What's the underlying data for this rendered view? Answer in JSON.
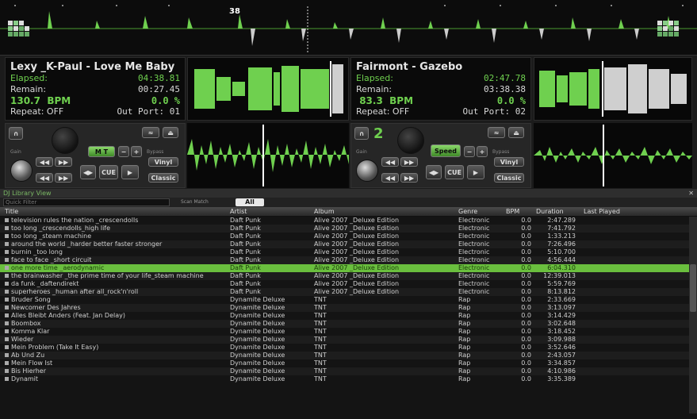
{
  "overview": {
    "beat_marker": "38"
  },
  "deck1": {
    "title": "Lexy _K-Paul - Love Me Baby",
    "elapsed_label": "Elapsed:",
    "elapsed": "04:38.81",
    "remain_label": "Remain:",
    "remain": "00:27.45",
    "bpm": "130.7",
    "bpm_label": "BPM",
    "pitch": "0.0 %",
    "repeat": "Repeat: OFF",
    "out_port": "Out Port: 01",
    "sync_label": "M T",
    "cue_label": "CUE",
    "vinyl_label": "Vinyl",
    "classic_label": "Classic",
    "gain_label": "Gain",
    "bypass_label": "Bypass"
  },
  "deck2": {
    "title": "Fairmont - Gazebo",
    "elapsed_label": "Elapsed:",
    "elapsed": "02:47.78",
    "remain_label": "Remain:",
    "remain": "03:38.38",
    "bpm": "83.3",
    "bpm_label": "BPM",
    "pitch": "0.0 %",
    "repeat": "Repeat: OFF",
    "out_port": "Out Port: 02",
    "deck_number": "2",
    "speed_label": "Speed",
    "cue_label": "CUE",
    "vinyl_label": "Vinyl",
    "classic_label": "Classic",
    "gain_label": "Gain",
    "bypass_label": "Bypass"
  },
  "library": {
    "title": "DJ Library View",
    "search_placeholder": "Quick Filter",
    "find_label": "Scan Match",
    "all_label": "All",
    "columns": {
      "title": "Title",
      "artist": "Artist",
      "album": "Album",
      "genre": "Genre",
      "bpm": "BPM",
      "duration": "Duration",
      "last_played": "Last Played"
    },
    "rows": [
      {
        "title": "television rules the nation _crescendolls",
        "artist": "Daft Punk",
        "album": "Alive 2007 _Deluxe Edition",
        "genre": "Electronic",
        "bpm": "0.0",
        "dur": "2:47.289"
      },
      {
        "title": "too long _crescendolls_high life",
        "artist": "Daft Punk",
        "album": "Alive 2007 _Deluxe Edition",
        "genre": "Electronic",
        "bpm": "0.0",
        "dur": "7:41.792"
      },
      {
        "title": "too long _steam machine",
        "artist": "Daft Punk",
        "album": "Alive 2007 _Deluxe Edition",
        "genre": "Electronic",
        "bpm": "0.0",
        "dur": "1:33.213"
      },
      {
        "title": "around the world _harder better faster stronger",
        "artist": "Daft Punk",
        "album": "Alive 2007 _Deluxe Edition",
        "genre": "Electronic",
        "bpm": "0.0",
        "dur": "7:26.496"
      },
      {
        "title": "burnin _too long",
        "artist": "Daft Punk",
        "album": "Alive 2007 _Deluxe Edition",
        "genre": "Electronic",
        "bpm": "0.0",
        "dur": "5:10.700"
      },
      {
        "title": "face to face _short circuit",
        "artist": "Daft Punk",
        "album": "Alive 2007 _Deluxe Edition",
        "genre": "Electronic",
        "bpm": "0.0",
        "dur": "4:56.444"
      },
      {
        "title": "one more time _aerodynamic",
        "artist": "Daft Punk",
        "album": "Alive 2007 _Deluxe Edition",
        "genre": "Electronic",
        "bpm": "0.0",
        "dur": "6:04.310"
      },
      {
        "title": "the brainwasher _the prime time of your life_steam machine",
        "artist": "Daft Punk",
        "album": "Alive 2007 _Deluxe Edition",
        "genre": "Electronic",
        "bpm": "0.0",
        "dur": "12:39.013"
      },
      {
        "title": "da funk _daftendirekt",
        "artist": "Daft Punk",
        "album": "Alive 2007 _Deluxe Edition",
        "genre": "Electronic",
        "bpm": "0.0",
        "dur": "5:59.769"
      },
      {
        "title": "superheroes _human after all_rock'n'roll",
        "artist": "Daft Punk",
        "album": "Alive 2007 _Deluxe Edition",
        "genre": "Electronic",
        "bpm": "0.0",
        "dur": "8:13.812"
      },
      {
        "title": "Bruder Song",
        "artist": "Dynamite Deluxe",
        "album": "TNT",
        "genre": "Rap",
        "bpm": "0.0",
        "dur": "2:33.669"
      },
      {
        "title": "Newcomer Des Jahres",
        "artist": "Dynamite Deluxe",
        "album": "TNT",
        "genre": "Rap",
        "bpm": "0.0",
        "dur": "3:13.097"
      },
      {
        "title": "Alles Bleibt Anders (Feat. Jan Delay)",
        "artist": "Dynamite Deluxe",
        "album": "TNT",
        "genre": "Rap",
        "bpm": "0.0",
        "dur": "3:14.429"
      },
      {
        "title": "Boombox",
        "artist": "Dynamite Deluxe",
        "album": "TNT",
        "genre": "Rap",
        "bpm": "0.0",
        "dur": "3:02.648"
      },
      {
        "title": "Komma Klar",
        "artist": "Dynamite Deluxe",
        "album": "TNT",
        "genre": "Rap",
        "bpm": "0.0",
        "dur": "3:18.452"
      },
      {
        "title": "Wieder",
        "artist": "Dynamite Deluxe",
        "album": "TNT",
        "genre": "Rap",
        "bpm": "0.0",
        "dur": "3:09.988"
      },
      {
        "title": "Mein Problem (Take It Easy)",
        "artist": "Dynamite Deluxe",
        "album": "TNT",
        "genre": "Rap",
        "bpm": "0.0",
        "dur": "3:52.646"
      },
      {
        "title": "Ab Und Zu",
        "artist": "Dynamite Deluxe",
        "album": "TNT",
        "genre": "Rap",
        "bpm": "0.0",
        "dur": "2:43.057"
      },
      {
        "title": "Mein Flow Ist",
        "artist": "Dynamite Deluxe",
        "album": "TNT",
        "genre": "Rap",
        "bpm": "0.0",
        "dur": "3:34.857"
      },
      {
        "title": "Bis Hierher",
        "artist": "Dynamite Deluxe",
        "album": "TNT",
        "genre": "Rap",
        "bpm": "0.0",
        "dur": "4:10.986"
      },
      {
        "title": "Dynamit",
        "artist": "Dynamite Deluxe",
        "album": "TNT",
        "genre": "Rap",
        "bpm": "0.0",
        "dur": "3:35.389"
      }
    ],
    "selected_index": 6
  }
}
